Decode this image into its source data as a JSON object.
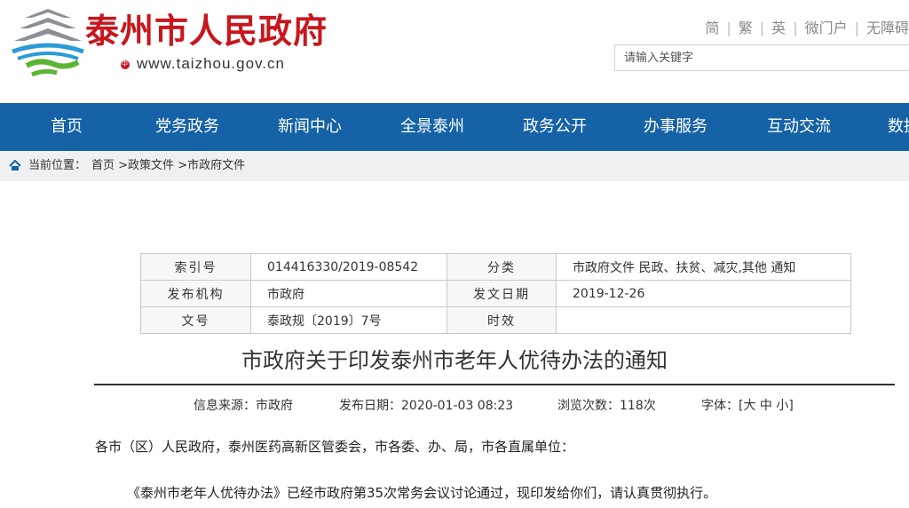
{
  "header": {
    "site_name": "泰州市人民政府",
    "site_url": "www.taizhou.gov.cn",
    "logo_badge": "中",
    "toplinks": [
      "简",
      "繁",
      "英",
      "微门户",
      "无障碍"
    ],
    "search_placeholder": "请输入关键字"
  },
  "nav": [
    "首页",
    "党务政务",
    "新闻中心",
    "全景泰州",
    "政务公开",
    "办事服务",
    "互动交流",
    "数据"
  ],
  "breadcrumb": {
    "label": "当前位置：",
    "items": [
      "首页",
      ">政策文件",
      ">市政府文件"
    ]
  },
  "meta": {
    "index_no_label": "索引号",
    "index_no": "014416330/2019-08542",
    "category_label": "分类",
    "category": "市政府文件 民政、扶贫、减灾,其他 通知",
    "issuer_label": "发布机构",
    "issuer": "市政府",
    "issue_date_label": "发文日期",
    "issue_date": "2019-12-26",
    "doc_no_label": "文号",
    "doc_no": "泰政规〔2019〕7号",
    "validity_label": "时效",
    "validity": ""
  },
  "article": {
    "title": "市政府关于印发泰州市老年人优待办法的通知",
    "source_label": "信息来源：",
    "source": "市政府",
    "pub_label": "发布日期：",
    "pub_date": "2020-01-03 08:23",
    "views_label": "浏览次数：",
    "views": "118次",
    "font_label": "字体：",
    "font_open": "[",
    "font_large": "大",
    "font_mid": "中",
    "font_small": "小",
    "font_close": "]",
    "p1": "各市（区）人民政府，泰州医药高新区管委会，市各委、办、局，市各直属单位：",
    "p2": "《泰州市老年人优待办法》已经市政府第35次常务会议讨论通过，现印发给你们，请认真贯彻执行。"
  },
  "colors": {
    "brand_red": "#c8161d",
    "nav_blue": "#1562a6",
    "crumb_bg": "#eef0f2"
  }
}
